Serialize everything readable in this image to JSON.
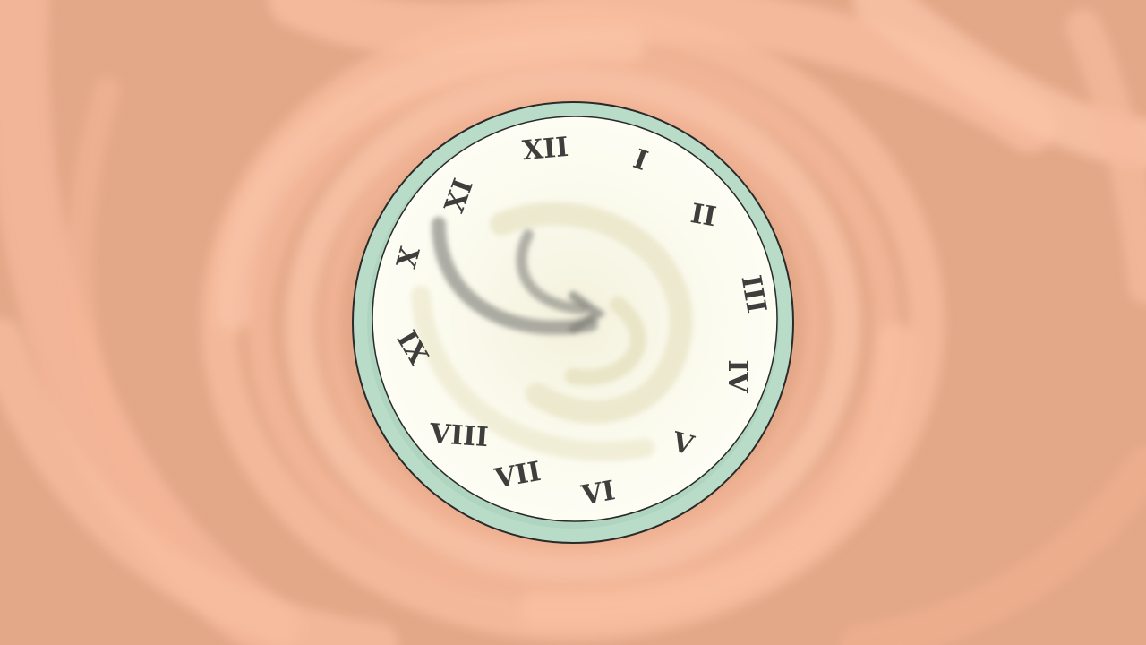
{
  "scene": {
    "description_colors": {
      "background": "#e3a888",
      "swirl_light": "#fbc1a6",
      "swirl_mid": "#f3b395",
      "clock_rim": "#b9dcc9",
      "clock_face": "#fbfbef",
      "ink": "#2a2a2a"
    },
    "clock": {
      "numerals": [
        {
          "text": "XII",
          "key": "n12"
        },
        {
          "text": "I",
          "key": "n1"
        },
        {
          "text": "II",
          "key": "n2"
        },
        {
          "text": "III",
          "key": "n3"
        },
        {
          "text": "IV",
          "key": "n4"
        },
        {
          "text": "V",
          "key": "n5"
        },
        {
          "text": "VI",
          "key": "n6"
        },
        {
          "text": "VII",
          "key": "n7"
        },
        {
          "text": "VIII",
          "key": "n8"
        },
        {
          "text": "IX",
          "key": "n9"
        },
        {
          "text": "X",
          "key": "n10"
        },
        {
          "text": "XI",
          "key": "n11"
        }
      ]
    }
  }
}
